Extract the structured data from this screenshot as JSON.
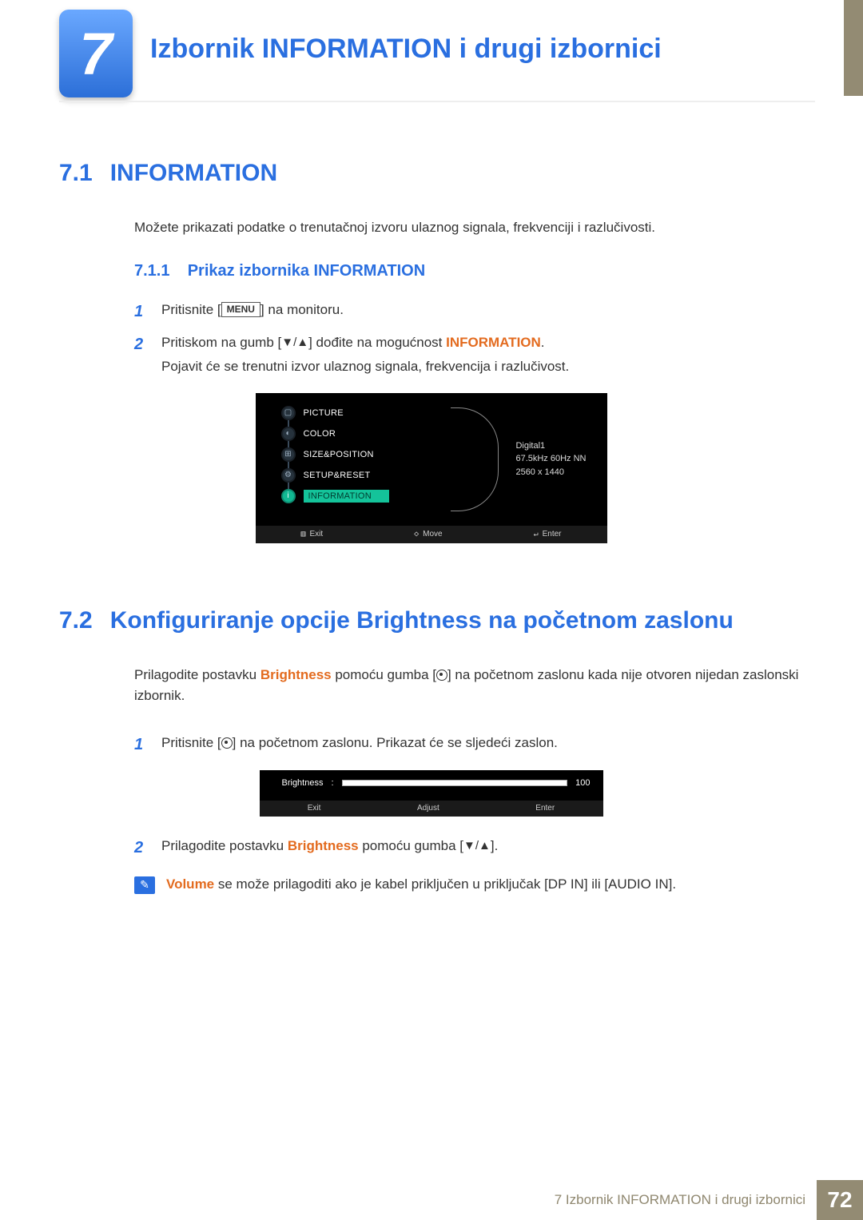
{
  "chapter": {
    "number": "7",
    "title": "Izbornik INFORMATION i drugi izbornici"
  },
  "s71": {
    "num": "7.1",
    "title": "INFORMATION",
    "intro": "Možete prikazati podatke o trenutačnoj izvoru ulaznog signala, frekvenciji i razlučivosti.",
    "sub_num": "7.1.1",
    "sub_title": "Prikaz izbornika INFORMATION",
    "step1_pre": "Pritisnite [",
    "step1_btn": "MENU",
    "step1_post": "] na monitoru.",
    "step2_pre": "Pritiskom na gumb [",
    "step2_post": "] dođite na mogućnost ",
    "step2_kw": "INFORMATION",
    "step2_end": ".",
    "step2_line2": "Pojavit će se trenutni izvor ulaznog signala, frekvencija i razlučivost."
  },
  "osd1": {
    "items": [
      "PICTURE",
      "COLOR",
      "SIZE&POSITION",
      "SETUP&RESET",
      "INFORMATION"
    ],
    "info": [
      "Digital1",
      "67.5kHz 60Hz NN",
      "2560 x 1440"
    ],
    "foot": {
      "exit": "Exit",
      "move": "Move",
      "enter": "Enter"
    }
  },
  "s72": {
    "num": "7.2",
    "title": "Konfiguriranje opcije Brightness na početnom zaslonu",
    "intro_pre": "Prilagodite postavku ",
    "intro_kw": "Brightness",
    "intro_mid": " pomoću gumba [",
    "intro_post": "] na početnom zaslonu kada nije otvoren nijedan zaslonski izbornik.",
    "step1_pre": "Pritisnite [",
    "step1_post": "] na početnom zaslonu. Prikazat će se sljedeći zaslon.",
    "step2_pre": "Prilagodite postavku ",
    "step2_kw": "Brightness",
    "step2_mid": " pomoću gumba [",
    "step2_post": "]."
  },
  "osd2": {
    "label": "Brightness",
    "sep": ":",
    "value": "100",
    "foot": {
      "exit": "Exit",
      "adjust": "Adjust",
      "enter": "Enter"
    }
  },
  "note": {
    "kw": "Volume",
    "text": "  se može prilagoditi ako je kabel priključen u priključak [DP IN] ili [AUDIO IN]."
  },
  "footer": {
    "text": "7 Izbornik INFORMATION i drugi izbornici",
    "page": "72"
  }
}
